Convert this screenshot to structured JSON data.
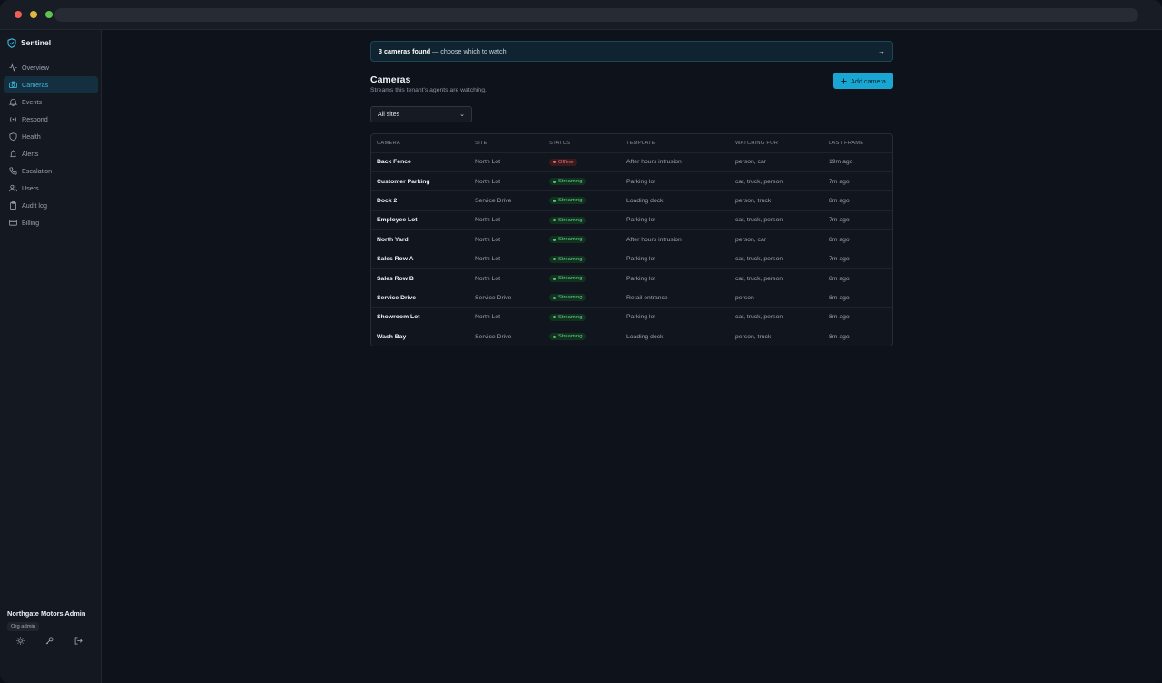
{
  "app": {
    "name": "Sentinel"
  },
  "sidebar": {
    "items": [
      {
        "label": "Overview",
        "icon": "activity-icon",
        "active": false
      },
      {
        "label": "Cameras",
        "icon": "camera-icon",
        "active": true
      },
      {
        "label": "Events",
        "icon": "bell-icon",
        "active": false
      },
      {
        "label": "Respond",
        "icon": "broadcast-icon",
        "active": false
      },
      {
        "label": "Health",
        "icon": "shield-icon",
        "active": false
      },
      {
        "label": "Alerts",
        "icon": "siren-icon",
        "active": false
      },
      {
        "label": "Escalation",
        "icon": "phone-icon",
        "active": false
      },
      {
        "label": "Users",
        "icon": "users-icon",
        "active": false
      },
      {
        "label": "Audit log",
        "icon": "clipboard-icon",
        "active": false
      },
      {
        "label": "Billing",
        "icon": "card-icon",
        "active": false
      }
    ],
    "user": {
      "name": "Northgate Motors Admin",
      "role": "Org admin"
    }
  },
  "banner": {
    "strong": "3 cameras found",
    "rest": " — choose which to watch",
    "arrow": "→"
  },
  "page": {
    "title": "Cameras",
    "subtitle": "Streams this tenant's agents are watching.",
    "add_button": "Add camera",
    "site_filter": "All sites"
  },
  "table": {
    "headers": [
      "CAMERA",
      "SITE",
      "STATUS",
      "TEMPLATE",
      "WATCHING FOR",
      "LAST FRAME"
    ],
    "rows": [
      {
        "camera": "Back Fence",
        "site": "North Lot",
        "status": "Offline",
        "template": "After hours intrusion",
        "watching": "person, car",
        "last": "19m ago"
      },
      {
        "camera": "Customer Parking",
        "site": "North Lot",
        "status": "Streaming",
        "template": "Parking lot",
        "watching": "car, truck, person",
        "last": "7m ago"
      },
      {
        "camera": "Dock 2",
        "site": "Service Drive",
        "status": "Streaming",
        "template": "Loading dock",
        "watching": "person, truck",
        "last": "8m ago"
      },
      {
        "camera": "Employee Lot",
        "site": "North Lot",
        "status": "Streaming",
        "template": "Parking lot",
        "watching": "car, truck, person",
        "last": "7m ago"
      },
      {
        "camera": "North Yard",
        "site": "North Lot",
        "status": "Streaming",
        "template": "After hours intrusion",
        "watching": "person, car",
        "last": "8m ago"
      },
      {
        "camera": "Sales Row A",
        "site": "North Lot",
        "status": "Streaming",
        "template": "Parking lot",
        "watching": "car, truck, person",
        "last": "7m ago"
      },
      {
        "camera": "Sales Row B",
        "site": "North Lot",
        "status": "Streaming",
        "template": "Parking lot",
        "watching": "car, truck, person",
        "last": "8m ago"
      },
      {
        "camera": "Service Drive",
        "site": "Service Drive",
        "status": "Streaming",
        "template": "Retail entrance",
        "watching": "person",
        "last": "8m ago"
      },
      {
        "camera": "Showroom Lot",
        "site": "North Lot",
        "status": "Streaming",
        "template": "Parking lot",
        "watching": "car, truck, person",
        "last": "8m ago"
      },
      {
        "camera": "Wash Bay",
        "site": "Service Drive",
        "status": "Streaming",
        "template": "Loading dock",
        "watching": "person, truck",
        "last": "8m ago"
      }
    ]
  },
  "colors": {
    "accent": "#1aa6d3",
    "streaming": "#4cc97b",
    "offline": "#e26464"
  }
}
